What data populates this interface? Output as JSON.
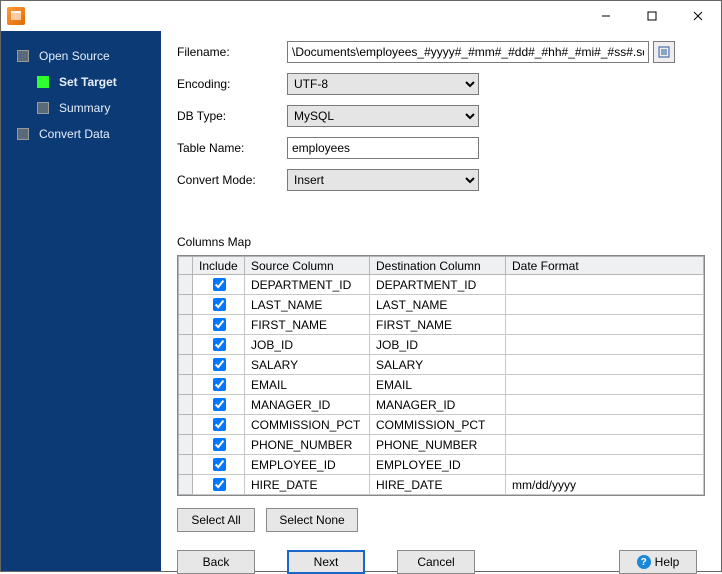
{
  "sidebar": {
    "items": [
      {
        "label": "Open Source"
      },
      {
        "label": "Set Target"
      },
      {
        "label": "Summary"
      },
      {
        "label": "Convert Data"
      }
    ]
  },
  "form": {
    "filename_label": "Filename:",
    "filename_value": "\\Documents\\employees_#yyyy#_#mm#_#dd#_#hh#_#mi#_#ss#.sql",
    "encoding_label": "Encoding:",
    "encoding_value": "UTF-8",
    "dbtype_label": "DB Type:",
    "dbtype_value": "MySQL",
    "tablename_label": "Table Name:",
    "tablename_value": "employees",
    "convertmode_label": "Convert Mode:",
    "convertmode_value": "Insert"
  },
  "columns_map": {
    "title": "Columns Map",
    "headers": {
      "include": "Include",
      "source": "Source Column",
      "dest": "Destination Column",
      "datefmt": "Date Format"
    },
    "rows": [
      {
        "include": true,
        "source": "DEPARTMENT_ID",
        "dest": "DEPARTMENT_ID",
        "datefmt": ""
      },
      {
        "include": true,
        "source": "LAST_NAME",
        "dest": "LAST_NAME",
        "datefmt": ""
      },
      {
        "include": true,
        "source": "FIRST_NAME",
        "dest": "FIRST_NAME",
        "datefmt": ""
      },
      {
        "include": true,
        "source": "JOB_ID",
        "dest": "JOB_ID",
        "datefmt": ""
      },
      {
        "include": true,
        "source": "SALARY",
        "dest": "SALARY",
        "datefmt": ""
      },
      {
        "include": true,
        "source": "EMAIL",
        "dest": "EMAIL",
        "datefmt": ""
      },
      {
        "include": true,
        "source": "MANAGER_ID",
        "dest": "MANAGER_ID",
        "datefmt": ""
      },
      {
        "include": true,
        "source": "COMMISSION_PCT",
        "dest": "COMMISSION_PCT",
        "datefmt": ""
      },
      {
        "include": true,
        "source": "PHONE_NUMBER",
        "dest": "PHONE_NUMBER",
        "datefmt": ""
      },
      {
        "include": true,
        "source": "EMPLOYEE_ID",
        "dest": "EMPLOYEE_ID",
        "datefmt": ""
      },
      {
        "include": true,
        "source": "HIRE_DATE",
        "dest": "HIRE_DATE",
        "datefmt": "mm/dd/yyyy"
      }
    ]
  },
  "buttons": {
    "select_all": "Select All",
    "select_none": "Select None",
    "back": "Back",
    "next": "Next",
    "cancel": "Cancel",
    "help": "Help"
  }
}
